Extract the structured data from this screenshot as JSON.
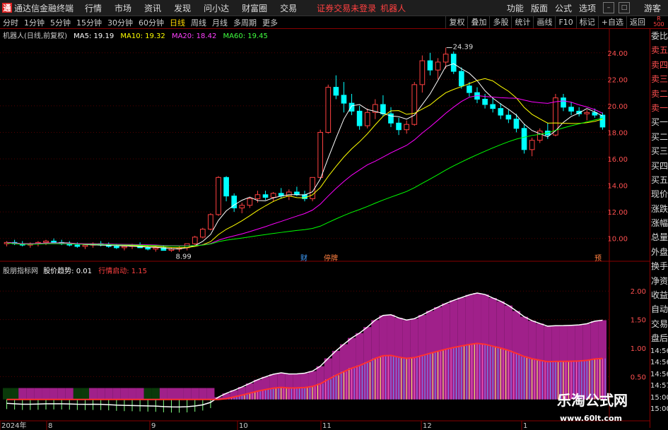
{
  "app": {
    "logo_char": "通",
    "name": "通达信金融终端",
    "menu": [
      "行情",
      "市场",
      "资讯",
      "发现",
      "问小达",
      "财富圈",
      "交易"
    ],
    "notice": "证券交易未登录",
    "robot_label": "机器人",
    "right_menu": [
      "功能",
      "版面",
      "公式",
      "选项"
    ],
    "guest": "游客"
  },
  "periods": [
    "分时",
    "1分钟",
    "5分钟",
    "15分钟",
    "30分钟",
    "60分钟",
    "日线",
    "周线",
    "月线",
    "多周期",
    "更多"
  ],
  "active_period": "日线",
  "tools": [
    "复权",
    "叠加",
    "多股",
    "统计",
    "画线",
    "F10",
    "标记",
    "+自选",
    "返回"
  ],
  "corner_badge": {
    "line1": "R",
    "line2": "500"
  },
  "main_legend": {
    "stock_label": "机器人(日线,前复权)",
    "ma5": "MA5: 19.19",
    "ma10": "MA10: 19.32",
    "ma20": "MA20: 18.42",
    "ma60": "MA60: 19.45",
    "colors": {
      "ma5": "#ffffff",
      "ma10": "#ffff00",
      "ma20": "#ff00ff",
      "ma60": "#00ff00"
    }
  },
  "price_axis": [
    "24.00",
    "22.00",
    "20.00",
    "18.00",
    "16.00",
    "14.00",
    "12.00",
    "10.00"
  ],
  "annotations": {
    "high": "24.39",
    "low": "8.99",
    "marker_cai": "财",
    "marker_pause": "停牌",
    "marker_yu": "预"
  },
  "ind_legend": {
    "name": "股朋指标网",
    "label1": "股价趋势: 0.01",
    "label2": "行情启动: 1.15"
  },
  "ind_axis": [
    "2.00",
    "1.50",
    "1.00",
    "0.50"
  ],
  "date_axis": [
    "2024年",
    "8",
    "9",
    "10",
    "11",
    "12",
    "1"
  ],
  "sidebar": [
    "委比",
    "卖五",
    "卖四",
    "卖三",
    "卖二",
    "卖一",
    "买一",
    "买二",
    "买三",
    "买四",
    "买五",
    "现价",
    "涨跌",
    "涨幅",
    "总量",
    "外盘",
    "换手",
    "净资",
    "收益"
  ],
  "sidebar2": [
    "自动",
    "交易",
    "盘后"
  ],
  "sidebar_times": [
    "14:56",
    "14:56",
    "14:56",
    "14:57",
    "15:00",
    "15:00"
  ],
  "watermark": {
    "line1": "乐淘公式网",
    "line2": "www.60lt.com"
  },
  "chart_data": {
    "type": "candlestick",
    "y_range": [
      8.6,
      25.0
    ],
    "ohlc": [
      [
        9.6,
        9.8,
        9.4,
        9.7
      ],
      [
        9.7,
        9.9,
        9.5,
        9.6
      ],
      [
        9.6,
        9.8,
        9.4,
        9.5
      ],
      [
        9.5,
        9.7,
        9.3,
        9.6
      ],
      [
        9.6,
        9.8,
        9.4,
        9.7
      ],
      [
        9.7,
        9.9,
        9.5,
        9.8
      ],
      [
        9.8,
        10.0,
        9.6,
        9.7
      ],
      [
        9.7,
        9.9,
        9.5,
        9.6
      ],
      [
        9.6,
        9.8,
        9.4,
        9.5
      ],
      [
        9.5,
        9.7,
        9.3,
        9.4
      ],
      [
        9.4,
        9.6,
        9.2,
        9.5
      ],
      [
        9.5,
        9.7,
        9.3,
        9.6
      ],
      [
        9.6,
        9.8,
        9.4,
        9.5
      ],
      [
        9.5,
        9.7,
        9.3,
        9.4
      ],
      [
        9.4,
        9.6,
        9.2,
        9.3
      ],
      [
        9.3,
        9.5,
        9.1,
        9.4
      ],
      [
        9.4,
        9.6,
        9.2,
        9.5
      ],
      [
        9.5,
        9.7,
        9.3,
        9.3
      ],
      [
        9.3,
        9.5,
        9.1,
        9.2
      ],
      [
        9.2,
        9.4,
        9.0,
        9.3
      ],
      [
        9.3,
        9.5,
        9.1,
        9.1
      ],
      [
        9.1,
        9.3,
        8.99,
        9.2
      ],
      [
        9.2,
        9.4,
        9.0,
        9.3
      ],
      [
        9.3,
        9.5,
        9.1,
        9.6
      ],
      [
        9.6,
        10.2,
        9.5,
        10.1
      ],
      [
        10.1,
        10.8,
        10.0,
        10.7
      ],
      [
        10.7,
        11.9,
        10.6,
        11.8
      ],
      [
        11.8,
        14.7,
        11.7,
        14.6
      ],
      [
        14.6,
        14.7,
        12.8,
        13.2
      ],
      [
        13.2,
        13.4,
        12.0,
        12.3
      ],
      [
        12.3,
        12.7,
        11.9,
        12.5
      ],
      [
        12.5,
        13.1,
        12.3,
        13.0
      ],
      [
        13.0,
        13.6,
        12.7,
        13.3
      ],
      [
        13.3,
        13.6,
        12.9,
        13.1
      ],
      [
        13.1,
        13.5,
        12.8,
        13.4
      ],
      [
        13.4,
        13.8,
        13.0,
        13.2
      ],
      [
        13.2,
        13.7,
        12.9,
        13.5
      ],
      [
        13.5,
        13.9,
        13.2,
        13.3
      ],
      [
        13.3,
        13.6,
        12.8,
        13.0
      ],
      [
        13.0,
        13.5,
        12.8,
        14.6
      ],
      [
        14.6,
        18.2,
        14.5,
        18.0
      ],
      [
        18.0,
        21.6,
        17.9,
        21.4
      ],
      [
        21.4,
        22.3,
        20.5,
        20.8
      ],
      [
        20.8,
        21.8,
        19.5,
        20.2
      ],
      [
        20.2,
        20.9,
        19.3,
        19.6
      ],
      [
        19.6,
        20.0,
        18.2,
        18.5
      ],
      [
        18.5,
        19.8,
        18.3,
        19.5
      ],
      [
        19.5,
        20.5,
        19.0,
        20.1
      ],
      [
        20.1,
        20.8,
        19.2,
        19.4
      ],
      [
        19.4,
        19.9,
        18.4,
        18.7
      ],
      [
        18.7,
        19.1,
        17.8,
        18.2
      ],
      [
        18.2,
        18.9,
        17.9,
        18.6
      ],
      [
        18.6,
        21.8,
        18.5,
        21.6
      ],
      [
        21.6,
        23.8,
        21.0,
        23.4
      ],
      [
        23.4,
        24.0,
        22.3,
        22.7
      ],
      [
        22.7,
        23.6,
        22.0,
        23.3
      ],
      [
        23.3,
        24.39,
        22.8,
        23.9
      ],
      [
        23.9,
        24.1,
        22.4,
        22.6
      ],
      [
        22.6,
        22.9,
        21.3,
        21.5
      ],
      [
        21.5,
        21.8,
        20.7,
        21.0
      ],
      [
        21.0,
        21.4,
        20.2,
        20.5
      ],
      [
        20.5,
        20.9,
        19.8,
        20.1
      ],
      [
        20.1,
        20.6,
        19.5,
        19.8
      ],
      [
        19.8,
        20.2,
        19.0,
        19.3
      ],
      [
        19.3,
        19.7,
        18.7,
        19.0
      ],
      [
        19.0,
        19.4,
        18.0,
        18.3
      ],
      [
        18.3,
        18.6,
        16.4,
        16.7
      ],
      [
        16.7,
        17.6,
        16.2,
        17.4
      ],
      [
        17.4,
        18.3,
        17.2,
        18.1
      ],
      [
        18.1,
        18.7,
        17.5,
        17.8
      ],
      [
        17.8,
        20.9,
        17.7,
        20.6
      ],
      [
        20.6,
        20.9,
        19.6,
        19.9
      ],
      [
        19.9,
        20.3,
        19.3,
        19.6
      ],
      [
        19.6,
        19.9,
        19.2,
        19.4
      ],
      [
        19.4,
        19.7,
        18.9,
        19.5
      ],
      [
        19.5,
        19.8,
        19.1,
        19.3
      ],
      [
        19.3,
        19.5,
        18.2,
        18.4
      ]
    ],
    "indicator": {
      "range": [
        -0.3,
        2.3
      ],
      "trend_first_value": 0.1,
      "start_value_last": 1.15
    }
  }
}
